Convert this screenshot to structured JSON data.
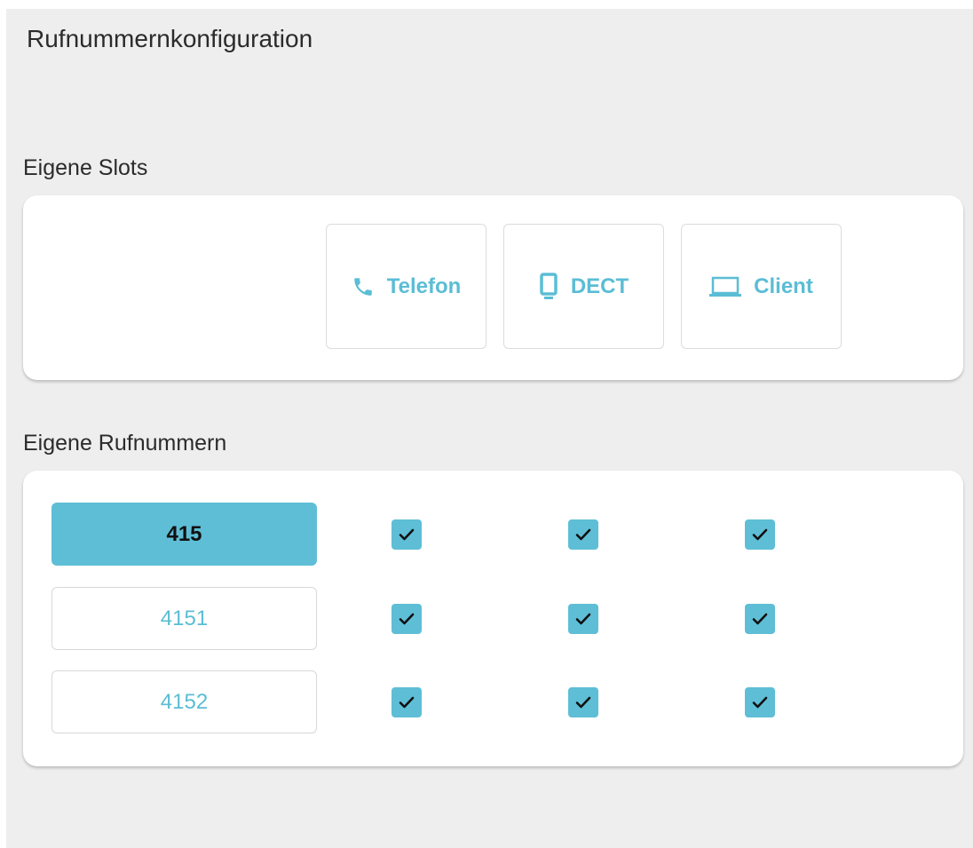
{
  "page_title": "Rufnummernkonfiguration",
  "slots_section": {
    "heading": "Eigene Slots",
    "slots": [
      {
        "label": "Telefon",
        "icon": "phone-icon"
      },
      {
        "label": "DECT",
        "icon": "dect-handset-icon"
      },
      {
        "label": "Client",
        "icon": "laptop-icon"
      }
    ]
  },
  "numbers_section": {
    "heading": "Eigene Rufnummern",
    "rows": [
      {
        "number": "415",
        "active": true,
        "checks": [
          true,
          true,
          true
        ]
      },
      {
        "number": "4151",
        "active": false,
        "checks": [
          true,
          true,
          true
        ]
      },
      {
        "number": "4152",
        "active": false,
        "checks": [
          true,
          true,
          true
        ]
      }
    ]
  },
  "colors": {
    "accent": "#5ebed6",
    "panel_background": "#eeeeee",
    "card_background": "#ffffff",
    "text": "#2b2b2b"
  }
}
